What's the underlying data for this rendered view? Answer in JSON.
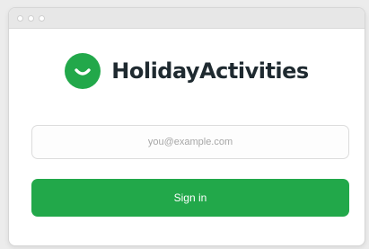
{
  "window": {
    "controls": [
      "close",
      "minimize",
      "maximize"
    ]
  },
  "brand": {
    "name": "HolidayActivities",
    "icon": "smiley-face-icon",
    "color": "#22a84a"
  },
  "login": {
    "email_placeholder": "you@example.com",
    "email_value": "",
    "signin_label": "Sign in"
  }
}
